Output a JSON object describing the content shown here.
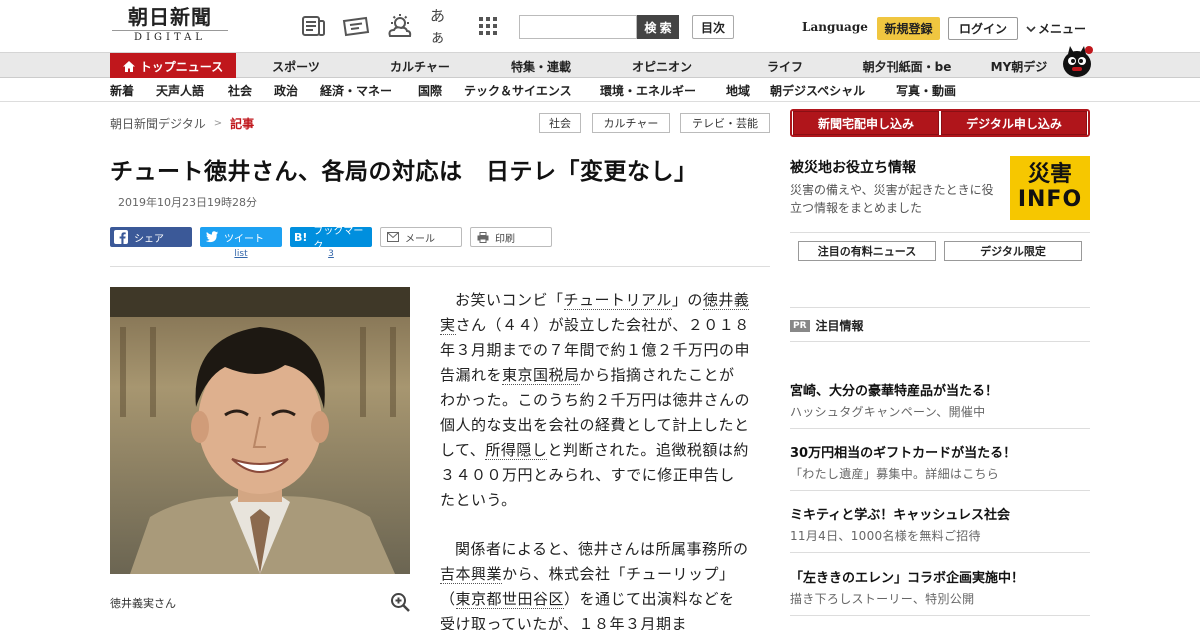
{
  "header": {
    "logo_main": "朝日新聞",
    "logo_sub": "DIGITAL",
    "icons": [
      "newspaper-icon",
      "ticket-icon",
      "weather-icon",
      "font-size-icon",
      "grid-icon"
    ],
    "font_icon_text": "あぁ",
    "search_placeholder": "",
    "search_button": "検 索",
    "toc_button": "目次",
    "language": "Language",
    "register": "新規登録",
    "login": "ログイン",
    "menu": "メニュー"
  },
  "category_nav": {
    "items": [
      "トップニュース",
      "スポーツ",
      "カルチャー",
      "特集・連載",
      "オピニオン",
      "ライフ",
      "朝夕刊紙面・be",
      "MY朝デジ"
    ],
    "active_index": 0
  },
  "sub_nav": {
    "items": [
      "新着",
      "天声人語",
      "社会",
      "政治",
      "経済・マネー",
      "国際",
      "テック＆サイエンス",
      "環境・エネルギー",
      "地域",
      "朝デジスペシャル",
      "写真・動画"
    ]
  },
  "breadcrumb": {
    "home": "朝日新聞デジタル",
    "separator": ">",
    "current": "記事"
  },
  "tags": [
    "社会",
    "カルチャー",
    "テレビ・芸能"
  ],
  "article": {
    "headline": "チュート徳井さん、各局の対応は　日テレ「変更なし」",
    "date": "2019年10月23日19時28分",
    "share": {
      "facebook": "シェア",
      "twitter": "ツイート",
      "twitter_count": "list",
      "hatena": "ブックマーク",
      "hatena_prefix": "B!",
      "hatena_count": "3",
      "mail": "メール",
      "print": "印刷"
    },
    "photo_caption": "徳井義実さん",
    "paragraph1": {
      "t1": "お笑いコンビ「",
      "l1": "チュートリアル",
      "t2": "」の",
      "l2": "徳井義実",
      "t3": "さん（４４）が設立した会社が、２０１８年３月期までの７年間で約１億２千万円の申告漏れを",
      "l3": "東京国税局",
      "t4": "から指摘されたことがわかった。このうち約２千万円は徳井さんの個人的な支出を会社の経費として計上したとして、",
      "l4": "所得隠し",
      "t5": "と判断された。追徴税額は約３４００万円とみられ、すでに修正申告したという。"
    },
    "paragraph2": {
      "t1": "関係者によると、徳井さんは所属事務所の",
      "l1": "吉本興業",
      "t2": "から、株式会社「チューリップ」（",
      "l2": "東京都世田谷区",
      "t3": "）を通じて出演料などを受け取っていたが、１８年３月期ま"
    }
  },
  "sidebar": {
    "buttons": [
      "新聞宅配申し込み",
      "デジタル申し込み"
    ],
    "disaster": {
      "title": "被災地お役立ち情報",
      "desc": "災害の備えや、災害が起きたときに役立つ情報をまとめました",
      "logo_line1": "災害",
      "logo_line2": "INFO"
    },
    "tabs": [
      "注目の有料ニュース",
      "デジタル限定"
    ],
    "pr_badge": "PR",
    "pr_title": "注目情報",
    "promos": [
      {
        "title": "宮崎、大分の豪華特産品が当たる！",
        "sub": "ハッシュタグキャンペーン、開催中"
      },
      {
        "title": "30万円相当のギフトカードが当たる！",
        "sub": "「わたし遺産」募集中。詳細はこちら"
      },
      {
        "title": "ミキティと学ぶ！キャッシュレス社会",
        "sub": "11月4日、1000名様を無料ご招待"
      },
      {
        "title": "「左ききのエレン」コラボ企画実施中！",
        "sub": "描き下ろしストーリー、特別公開"
      }
    ]
  },
  "colors": {
    "brand_red": "#c0171c",
    "register_yellow": "#f0c640",
    "facebook": "#3b5998",
    "twitter": "#1da1f2",
    "hatena": "#008fde",
    "disaster_yellow": "#f6c700"
  }
}
